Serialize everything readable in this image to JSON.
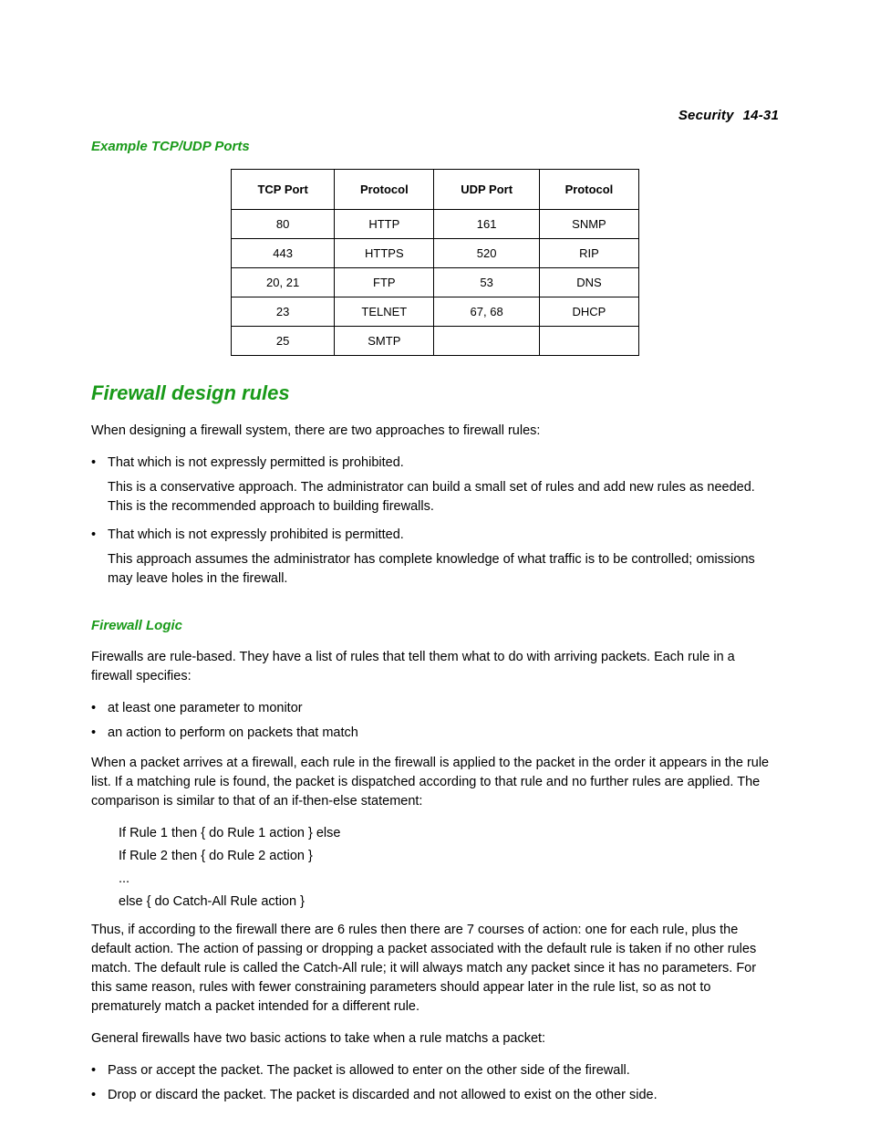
{
  "header": {
    "section": "Security",
    "page": "14-31"
  },
  "headings": {
    "ports": "Example TCP/UDP Ports",
    "design": "Firewall design rules",
    "logic": "Firewall Logic"
  },
  "table": {
    "head": [
      "TCP Port",
      "Protocol",
      "UDP Port",
      "Protocol"
    ],
    "rows": [
      [
        "80",
        "HTTP",
        "161",
        "SNMP"
      ],
      [
        "443",
        "HTTPS",
        "520",
        "RIP"
      ],
      [
        "20, 21",
        "FTP",
        "53",
        "DNS"
      ],
      [
        "23",
        "TELNET",
        "67, 68",
        "DHCP"
      ],
      [
        "25",
        "SMTP",
        "",
        ""
      ]
    ]
  },
  "design_paragraphs": {
    "p1": "When designing a firewall system, there are two approaches to firewall rules:",
    "b1_label": "•",
    "b1_title": "That which is not expressly permitted is prohibited.",
    "b1_body": "This is a conservative approach. The administrator can build a small set of rules and add new rules as needed. This is the recommended approach to building firewalls.",
    "b2_label": "•",
    "b2_title": "That which is not expressly prohibited is permitted.",
    "b2_body": "This approach assumes the administrator has complete knowledge of what traffic is to be controlled; omissions may leave holes in the firewall."
  },
  "logic_paragraphs": {
    "p1": "Firewalls are rule-based. They have a list of rules that tell them what to do with arriving packets. Each rule in a firewall specifies:",
    "r1_label": "•",
    "r1_text": "at least one parameter to monitor",
    "r2_label": "•",
    "r2_text": "an action to perform on packets that match",
    "p2": "When a packet arrives at a firewall, each rule in the firewall is applied to the packet in the order it appears in the rule list. If a matching rule is found, the packet is dispatched according to that rule and no further rules are applied. The comparison is similar to that of an if-then-else statement:",
    "c1": "If Rule 1 then { do Rule 1 action } else",
    "c2": "If Rule 2 then { do Rule 2 action }",
    "c3": "...",
    "c4": "else { do Catch-All Rule action }",
    "p3": "Thus, if according to the firewall there are 6 rules then there are 7 courses of action: one for each rule, plus the default action. The action of passing or dropping a packet associated with the default rule is taken if no other rules match. The default rule is called the Catch-All rule; it will always match any packet since it has no parameters. For this same reason, rules with fewer constraining parameters should appear later in the rule list, so as not to prematurely match a packet intended for a different rule.",
    "p4": "General firewalls have two basic actions to take when a rule matchs a packet:",
    "a1_label": "•",
    "a1_text": "Pass or accept the packet. The packet is allowed to enter on the other side of the firewall.",
    "a2_label": "•",
    "a2_text": "Drop or discard the packet. The packet is discarded and not allowed to exist on the other side."
  }
}
